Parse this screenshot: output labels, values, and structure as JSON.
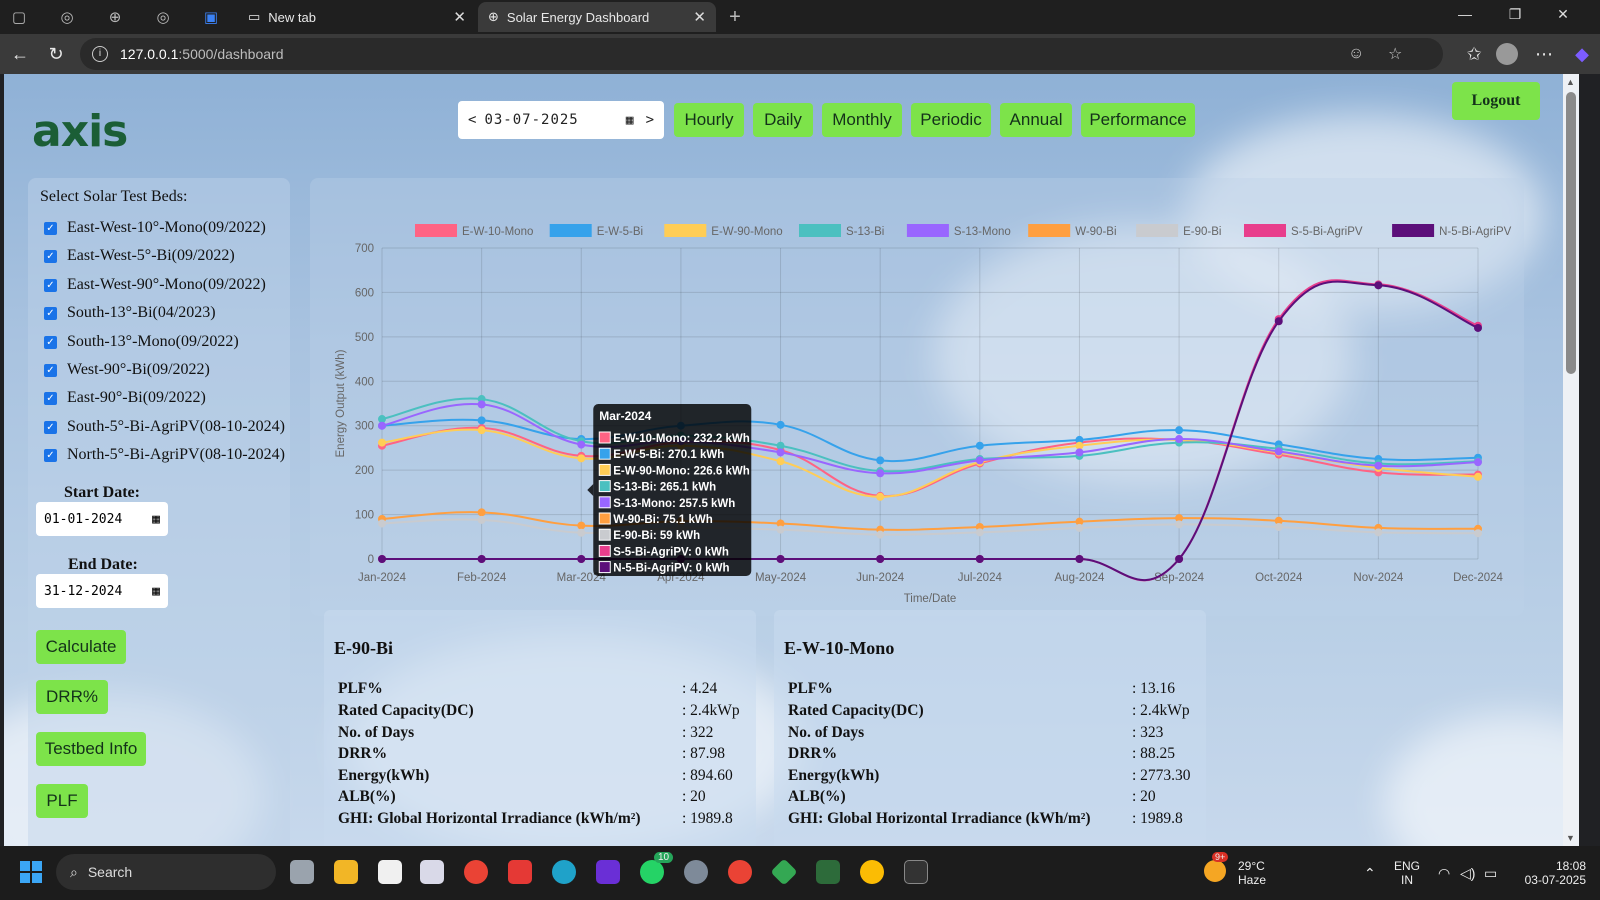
{
  "browser": {
    "tabs": [
      {
        "title": "New tab",
        "active": false
      },
      {
        "title": "Solar Energy Dashboard",
        "active": true
      }
    ],
    "address": {
      "host": "127.0.0.1",
      "path": ":5000/dashboard"
    }
  },
  "header": {
    "logo": "axis",
    "current_date": "03-07-2025",
    "prev_label": "<",
    "next_label": ">",
    "nav_buttons": [
      "Hourly",
      "Daily",
      "Monthly",
      "Periodic",
      "Annual",
      "Performance"
    ],
    "logout_label": "Logout"
  },
  "sidebar": {
    "title": "Select Solar Test Beds:",
    "testbeds": [
      "East-West-10°-Mono(09/2022)",
      "East-West-5°-Bi(09/2022)",
      "East-West-90°-Mono(09/2022)",
      "South-13°-Bi(04/2023)",
      "South-13°-Mono(09/2022)",
      "West-90°-Bi(09/2022)",
      "East-90°-Bi(09/2022)",
      "South-5°-Bi-AgriPV(08-10-2024)",
      "North-5°-Bi-AgriPV(08-10-2024)"
    ],
    "start_label": "Start Date:",
    "start_value": "01-01-2024",
    "end_label": "End Date:",
    "end_value": "31-12-2024",
    "actions": [
      "Calculate",
      "DRR%",
      "Testbed Info",
      "PLF"
    ]
  },
  "chart_data": {
    "type": "line",
    "xlabel": "Time/Date",
    "ylabel": "Energy Output (kWh)",
    "ylim": [
      0,
      700
    ],
    "yticks": [
      0,
      100,
      200,
      300,
      400,
      500,
      600,
      700
    ],
    "categories": [
      "Jan-2024",
      "Feb-2024",
      "Mar-2024",
      "Apr-2024",
      "May-2024",
      "Jun-2024",
      "Jul-2024",
      "Aug-2024",
      "Sep-2024",
      "Oct-2024",
      "Nov-2024",
      "Dec-2024"
    ],
    "legend_position": "top",
    "series": [
      {
        "name": "E-W-10-Mono",
        "color": "#ff6384",
        "values": [
          255,
          295,
          232.2,
          262,
          245,
          142,
          215,
          262,
          268,
          235,
          195,
          190
        ]
      },
      {
        "name": "E-W-5-Bi",
        "color": "#36a2eb",
        "values": [
          300,
          312,
          270.1,
          300,
          302,
          222,
          255,
          268,
          290,
          258,
          225,
          228
        ]
      },
      {
        "name": "E-W-90-Mono",
        "color": "#ffcd56",
        "values": [
          262,
          290,
          226.6,
          255,
          220,
          140,
          218,
          255,
          268,
          240,
          205,
          185
        ]
      },
      {
        "name": "S-13-Bi",
        "color": "#4bc0c0",
        "values": [
          315,
          360,
          265.1,
          278,
          255,
          198,
          225,
          232,
          262,
          248,
          215,
          220
        ]
      },
      {
        "name": "S-13-Mono",
        "color": "#9966ff",
        "values": [
          300,
          348,
          257.5,
          265,
          240,
          193,
          222,
          240,
          270,
          242,
          210,
          218
        ]
      },
      {
        "name": "W-90-Bi",
        "color": "#ff9f40",
        "values": [
          90,
          105,
          75.1,
          85,
          80,
          66,
          72,
          84,
          92,
          86,
          70,
          68
        ]
      },
      {
        "name": "E-90-Bi",
        "color": "#c9cbcf",
        "values": [
          80,
          88,
          59,
          70,
          66,
          55,
          60,
          70,
          78,
          72,
          60,
          58
        ]
      },
      {
        "name": "S-5-Bi-AgriPV",
        "color": "#e83e8c",
        "values": [
          0,
          0,
          0,
          0,
          0,
          0,
          0,
          0,
          0,
          540,
          618,
          525
        ]
      },
      {
        "name": "N-5-Bi-AgriPV",
        "color": "#5c0f7a",
        "values": [
          0,
          0,
          0,
          0,
          0,
          0,
          0,
          0,
          0,
          535,
          616,
          520
        ]
      }
    ],
    "tooltip": {
      "title": "Mar-2024",
      "lines": [
        "E-W-10-Mono: 232.2 kWh",
        "E-W-5-Bi: 270.1 kWh",
        "E-W-90-Mono: 226.6 kWh",
        "S-13-Bi: 265.1 kWh",
        "S-13-Mono: 257.5 kWh",
        "W-90-Bi: 75.1 kWh",
        "E-90-Bi: 59 kWh",
        "S-5-Bi-AgriPV: 0 kWh",
        "N-5-Bi-AgriPV: 0 kWh"
      ]
    }
  },
  "stats": [
    {
      "title": "E-90-Bi",
      "rows": [
        {
          "k": "PLF%",
          "v": ": 4.24"
        },
        {
          "k": "Rated Capacity(DC)",
          "v": ": 2.4kWp"
        },
        {
          "k": "No. of Days",
          "v": ": 322"
        },
        {
          "k": "DRR%",
          "v": ": 87.98"
        },
        {
          "k": "Energy(kWh)",
          "v": ": 894.60"
        },
        {
          "k": "ALB(%)",
          "v": ": 20"
        },
        {
          "k": "GHI: Global Horizontal Irradiance (kWh/m²)",
          "v": ": 1989.8"
        }
      ]
    },
    {
      "title": "E-W-10-Mono",
      "rows": [
        {
          "k": "PLF%",
          "v": ": 13.16"
        },
        {
          "k": "Rated Capacity(DC)",
          "v": ": 2.4kWp"
        },
        {
          "k": "No. of Days",
          "v": ": 323"
        },
        {
          "k": "DRR%",
          "v": ": 88.25"
        },
        {
          "k": "Energy(kWh)",
          "v": ": 2773.30"
        },
        {
          "k": "ALB(%)",
          "v": ": 20"
        },
        {
          "k": "GHI: Global Horizontal Irradiance (kWh/m²)",
          "v": ": 1989.8"
        }
      ]
    }
  ],
  "taskbar": {
    "search_label": "Search",
    "weather_temp": "29°C",
    "weather_desc": "Haze",
    "lang_top": "ENG",
    "lang_bottom": "IN",
    "time": "18:08",
    "date": "03-07-2025",
    "whatsapp_badge": "10",
    "weather_badge": "9+"
  }
}
